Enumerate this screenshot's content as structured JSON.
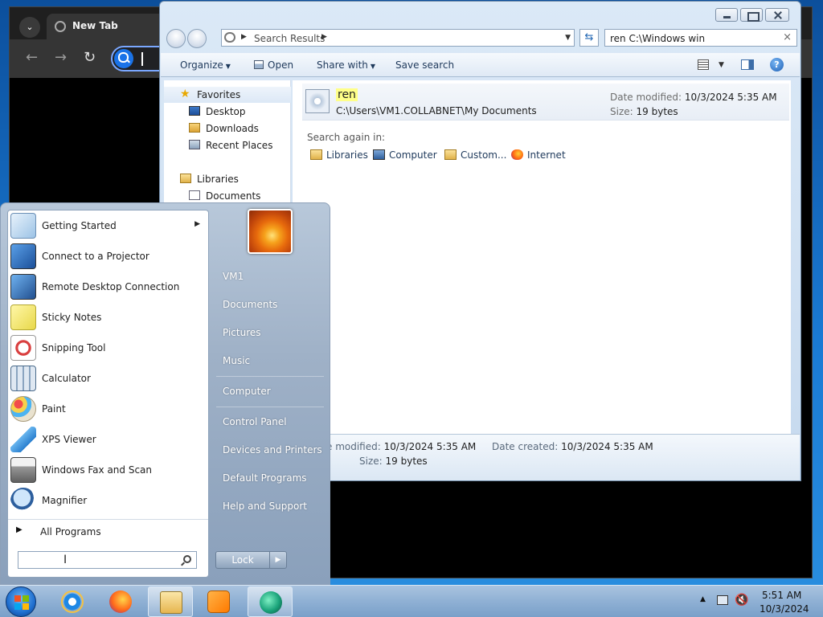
{
  "browser": {
    "tab_title": "New Tab",
    "menu_icon": "chevron-down-icon",
    "nav": {
      "back": "←",
      "forward": "→",
      "reload": "↻"
    }
  },
  "explorer": {
    "address": {
      "crumb": "Search Results"
    },
    "search": {
      "value": "ren C:\\Windows win"
    },
    "toolbar": {
      "organize": "Organize",
      "open": "Open",
      "share_with": "Share with",
      "save_search": "Save search"
    },
    "navpane": [
      {
        "label": "Favorites",
        "icon": "star-icon"
      },
      {
        "label": "Desktop",
        "icon": "desktop-icon"
      },
      {
        "label": "Downloads",
        "icon": "downloads-folder-icon"
      },
      {
        "label": "Recent Places",
        "icon": "recent-places-icon"
      },
      {
        "label": "Libraries",
        "icon": "libraries-icon"
      },
      {
        "label": "Documents",
        "icon": "documents-icon"
      }
    ],
    "result": {
      "name": "ren",
      "path": "C:\\Users\\VM1.COLLABNET\\My Documents",
      "date_modified_label": "Date modified:",
      "date_modified": "10/3/2024 5:35 AM",
      "size_label": "Size:",
      "size": "19 bytes"
    },
    "search_again": {
      "label": "Search again in:",
      "links": [
        {
          "label": "Libraries",
          "icon": "libraries-icon"
        },
        {
          "label": "Computer",
          "icon": "computer-icon"
        },
        {
          "label": "Custom...",
          "icon": "custom-folder-icon"
        },
        {
          "label": "Internet",
          "icon": "firefox-icon"
        }
      ]
    },
    "details": {
      "date_modified_label": "e modified:",
      "date_modified": "10/3/2024 5:35 AM",
      "date_created_label": "Date created:",
      "date_created": "10/3/2024 5:35 AM",
      "size_label": "Size:",
      "size": "19 bytes"
    }
  },
  "start_menu": {
    "programs": [
      {
        "label": "Getting Started",
        "icon": "getting-started-icon",
        "submenu": true
      },
      {
        "label": "Connect to a Projector",
        "icon": "projector-icon"
      },
      {
        "label": "Remote Desktop Connection",
        "icon": "remote-desktop-icon"
      },
      {
        "label": "Sticky Notes",
        "icon": "sticky-notes-icon"
      },
      {
        "label": "Snipping Tool",
        "icon": "snipping-tool-icon"
      },
      {
        "label": "Calculator",
        "icon": "calculator-icon"
      },
      {
        "label": "Paint",
        "icon": "paint-icon"
      },
      {
        "label": "XPS Viewer",
        "icon": "xps-viewer-icon"
      },
      {
        "label": "Windows Fax and Scan",
        "icon": "fax-scan-icon"
      },
      {
        "label": "Magnifier",
        "icon": "magnifier-icon"
      }
    ],
    "all_programs": "All Programs",
    "search_value": "",
    "right_links": [
      "VM1",
      "Documents",
      "Pictures",
      "Music",
      "Computer",
      "Control Panel",
      "Devices and Printers",
      "Default Programs",
      "Help and Support"
    ],
    "lock": "Lock"
  },
  "taskbar": {
    "pinned": [
      {
        "name": "internet-explorer",
        "icon": "ie-icon"
      },
      {
        "name": "firefox",
        "icon": "firefox-icon"
      },
      {
        "name": "windows-explorer",
        "icon": "folder-icon"
      },
      {
        "name": "media-player",
        "icon": "media-player-icon"
      },
      {
        "name": "app",
        "icon": "app-icon"
      }
    ],
    "clock": {
      "time": "5:51 AM",
      "date": "10/3/2024"
    }
  },
  "colors": {
    "highlight": "#ffff88",
    "link": "#1e395b",
    "accent": "#1a73e8"
  }
}
